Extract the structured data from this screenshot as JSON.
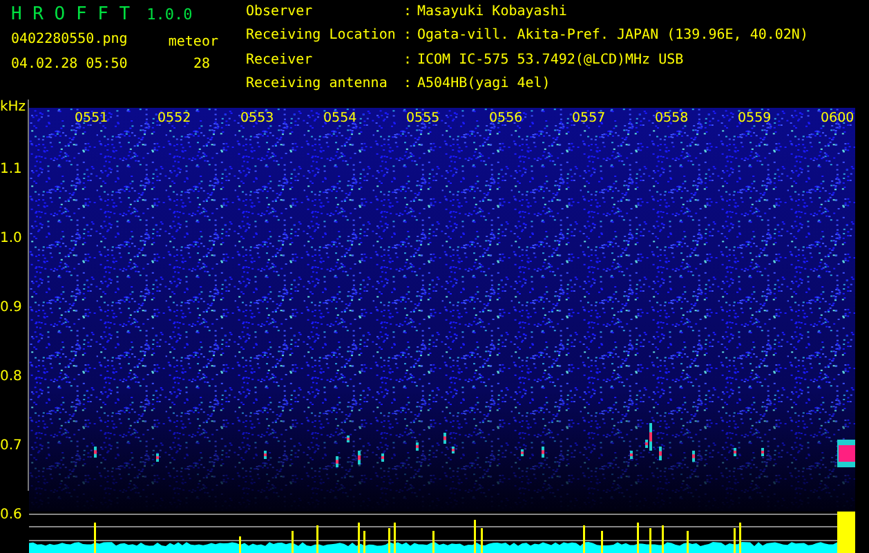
{
  "app": {
    "title": "H R O F F T",
    "version": "1.0.0",
    "file": "0402280550.png",
    "timestamp": "04.02.28 05:50",
    "meteor_label": "meteor",
    "meteor_count": "28"
  },
  "info": [
    {
      "label": "Observer",
      "separator": ":",
      "value": "Masayuki Kobayashi"
    },
    {
      "label": "Receiving Location",
      "separator": ":",
      "value": "Ogata-vill. Akita-Pref. JAPAN (139.96E, 40.02N)"
    },
    {
      "label": "Receiver",
      "separator": ":",
      "value": "ICOM IC-575 53.7492(@LCD)MHz USB"
    },
    {
      "label": "Receiving antenna",
      "separator": ":",
      "value": "A504HB(yagi 4el)"
    }
  ],
  "spectrogram": {
    "unit": "kHz",
    "frequency_labels": [
      "1.1",
      "1.0",
      "0.9",
      "0.8",
      "0.7",
      "0.6"
    ],
    "time_labels": [
      "0551",
      "0552",
      "0553",
      "0554",
      "0555",
      "0556",
      "0557",
      "0558",
      "0559",
      "0600"
    ]
  }
}
